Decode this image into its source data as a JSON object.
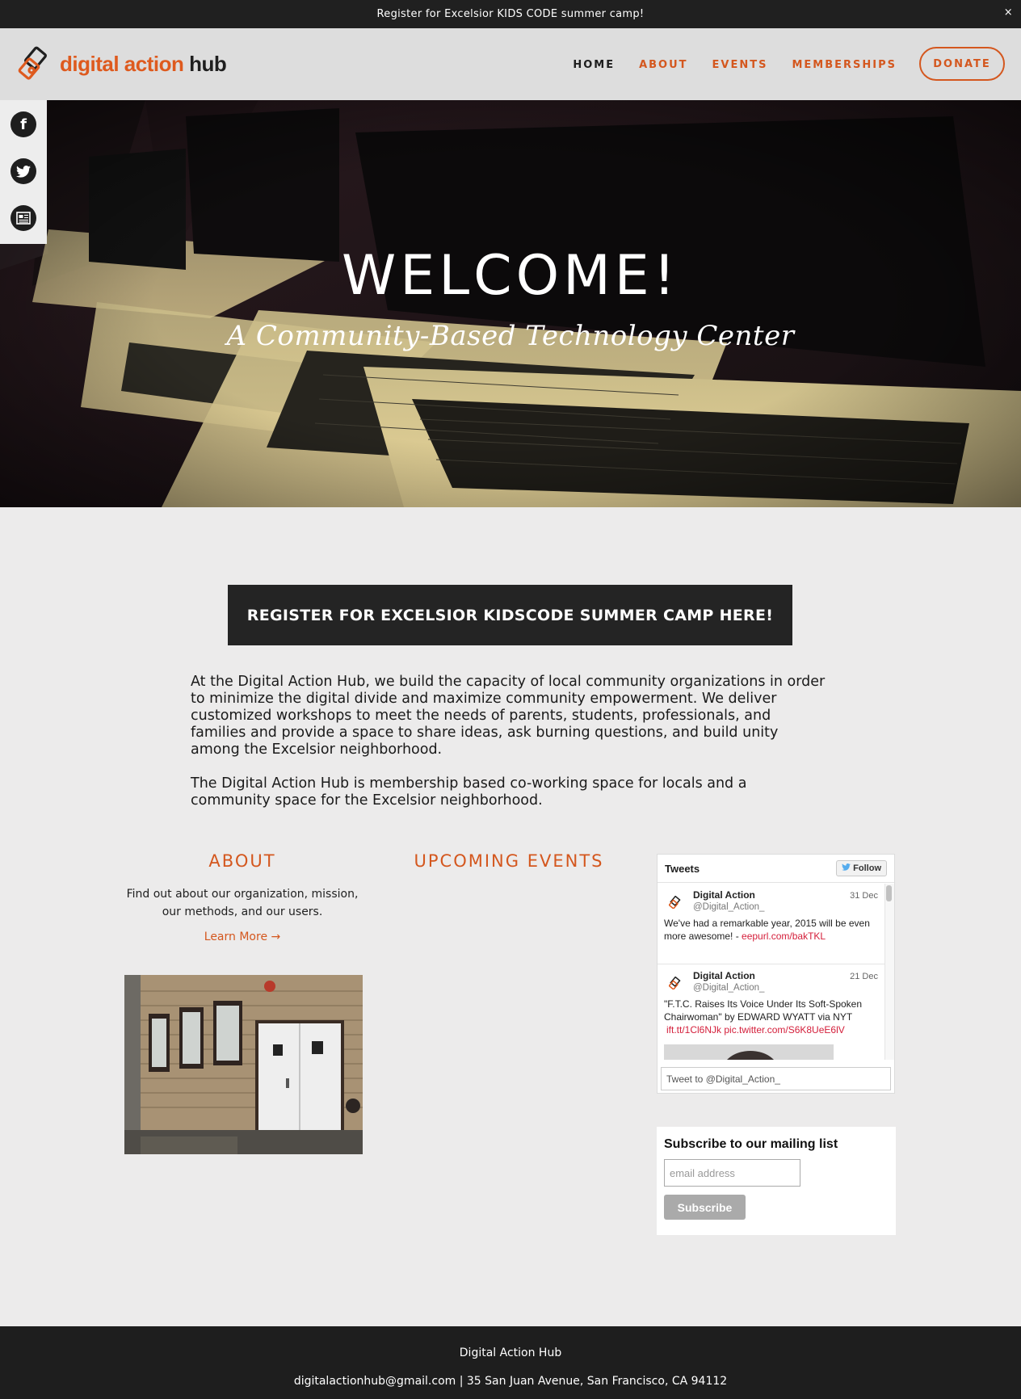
{
  "announcement": {
    "text": "Register for Excelsior KIDS CODE summer camp!",
    "close": "×"
  },
  "brand": {
    "orange_part": "digital action",
    "dark_part": "hub",
    "accent_color": "#d4571e",
    "dark_color": "#1f1f1f"
  },
  "nav": {
    "items": [
      "HOME",
      "ABOUT",
      "EVENTS",
      "MEMBERSHIPS"
    ],
    "active": "HOME",
    "donate": "DONATE"
  },
  "social": {
    "icons": [
      "facebook-icon",
      "twitter-icon",
      "newsletter-icon"
    ],
    "facebook_glyph": "f"
  },
  "hero": {
    "title": "WELCOME!",
    "subtitle": "A Community-Based Technology Center"
  },
  "cta": {
    "label": "REGISTER FOR EXCELSIOR KIDSCODE SUMMER CAMP HERE!"
  },
  "intro": {
    "p1": "At the Digital Action Hub, we build the capacity of local community organizations in order to minimize the digital divide and maximize community empowerment. We deliver customized workshops to meet the needs of parents, students, professionals, and families and provide a space to share ideas, ask burning questions, and build unity among the Excelsior neighborhood.",
    "p2": "The Digital Action Hub is membership based co-working space for locals and a community space for the Excelsior neighborhood."
  },
  "about": {
    "heading": "ABOUT",
    "text": "Find out about our organization, mission, our methods, and our users.",
    "link": "Learn More →"
  },
  "events": {
    "heading": "UPCOMING EVENTS"
  },
  "tweets": {
    "title": "Tweets",
    "follow": "Follow",
    "items": [
      {
        "name": "Digital Action",
        "handle": "@Digital_Action_",
        "date": "31 Dec",
        "text": "We've had a remarkable year, 2015 will be even more awesome! - ",
        "link": "eepurl.com/bakTKL"
      },
      {
        "name": "Digital Action",
        "handle": "@Digital_Action_",
        "date": "21 Dec",
        "text": "\"F.T.C. Raises Its Voice Under Its Soft-Spoken Chairwoman\" by EDWARD WYATT via NYT",
        "link": "ift.tt/1Cl6NJk pic.twitter.com/S6K8UeE6lV"
      }
    ],
    "compose_placeholder": "Tweet to @Digital_Action_"
  },
  "mailing": {
    "title": "Subscribe to our mailing list",
    "placeholder": "email address",
    "button": "Subscribe"
  },
  "footer": {
    "name": "Digital Action Hub",
    "contact": "digitalactionhub@gmail.com | 35 San Juan Avenue, San Francisco, CA 94112"
  }
}
